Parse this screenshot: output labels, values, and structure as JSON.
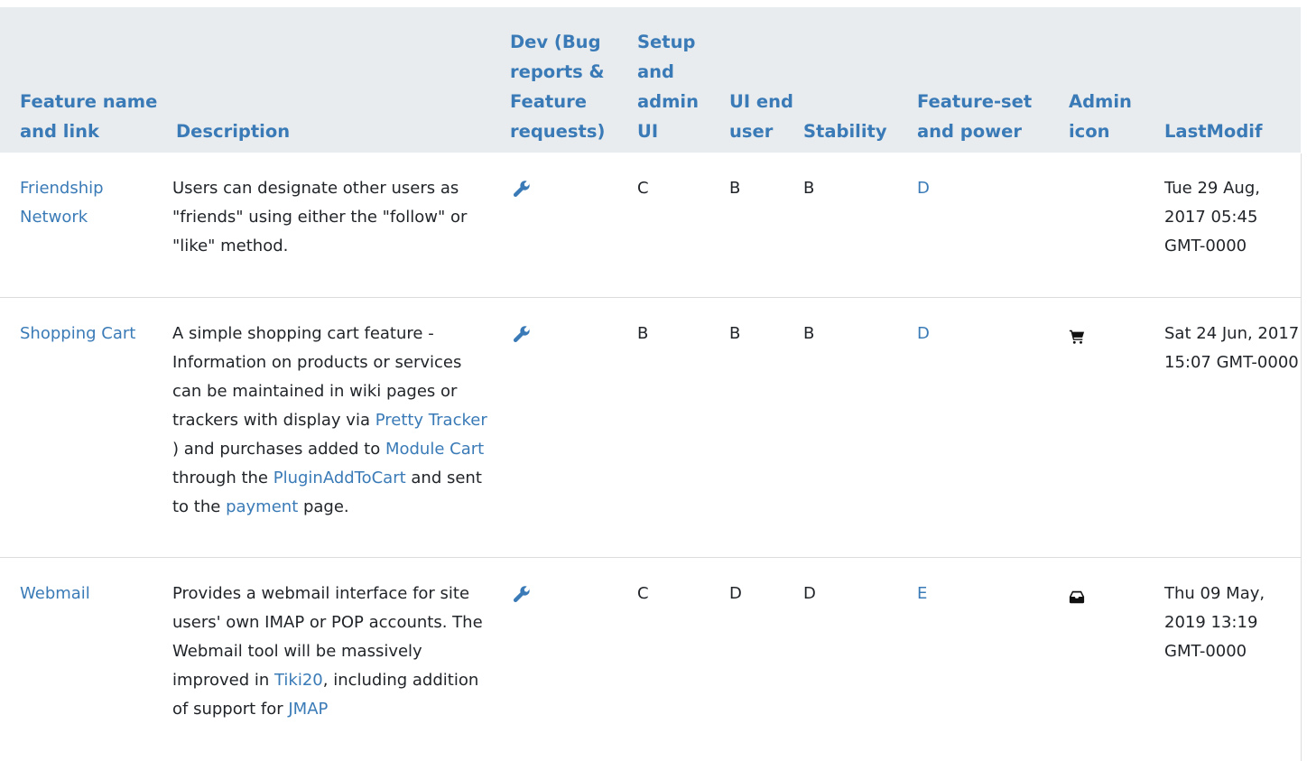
{
  "table": {
    "headers": [
      "Feature name and link",
      "Description",
      "Dev (Bug reports & Feature requests)",
      "Setup and admin UI",
      "UI end user",
      "Stability",
      "Feature-set and power",
      "Admin icon",
      "LastModif"
    ],
    "rows": [
      {
        "name": "Friendship Network",
        "description": "Users can designate other users as \"friends\" using either the \"follow\" or \"like\" method.",
        "dev_icon": "wrench-icon",
        "setup": "C",
        "ui": "B",
        "stability": "B",
        "power": "D",
        "admin_icon": "",
        "last_modified": "Tue 29 Aug, 2017 05:45 GMT-0000"
      },
      {
        "name": "Shopping Cart",
        "description_parts": {
          "p1": "A simple shopping cart feature - Information on products or services can be maintained in wiki pages or trackers with display via ",
          "link1": "Pretty Tracker",
          "p2": " ) and purchases added to ",
          "link2": "Module Cart",
          "p3": " through the ",
          "link3": "PluginAddToCart",
          "p4": " and sent to the ",
          "link4": "payment",
          "p5": " page."
        },
        "dev_icon": "wrench-icon",
        "setup": "B",
        "ui": "B",
        "stability": "B",
        "power": "D",
        "admin_icon": "shopping-cart-icon",
        "last_modified": "Sat 24 Jun, 2017 15:07 GMT-0000"
      },
      {
        "name": "Webmail",
        "description_parts": {
          "p1": "Provides a webmail interface for site users' own IMAP or POP accounts. The Webmail tool will be massively improved in ",
          "link1": "Tiki20",
          "p2": ", including addition of support for ",
          "link2": "JMAP"
        },
        "dev_icon": "wrench-icon",
        "setup": "C",
        "ui": "D",
        "stability": "D",
        "power": "E",
        "admin_icon": "inbox-icon",
        "last_modified": "Thu 09 May, 2019 13:19 GMT-0000"
      }
    ]
  },
  "colors": {
    "link": "#3a7bb7",
    "header_bg": "#e9ecef",
    "text": "#212529"
  }
}
